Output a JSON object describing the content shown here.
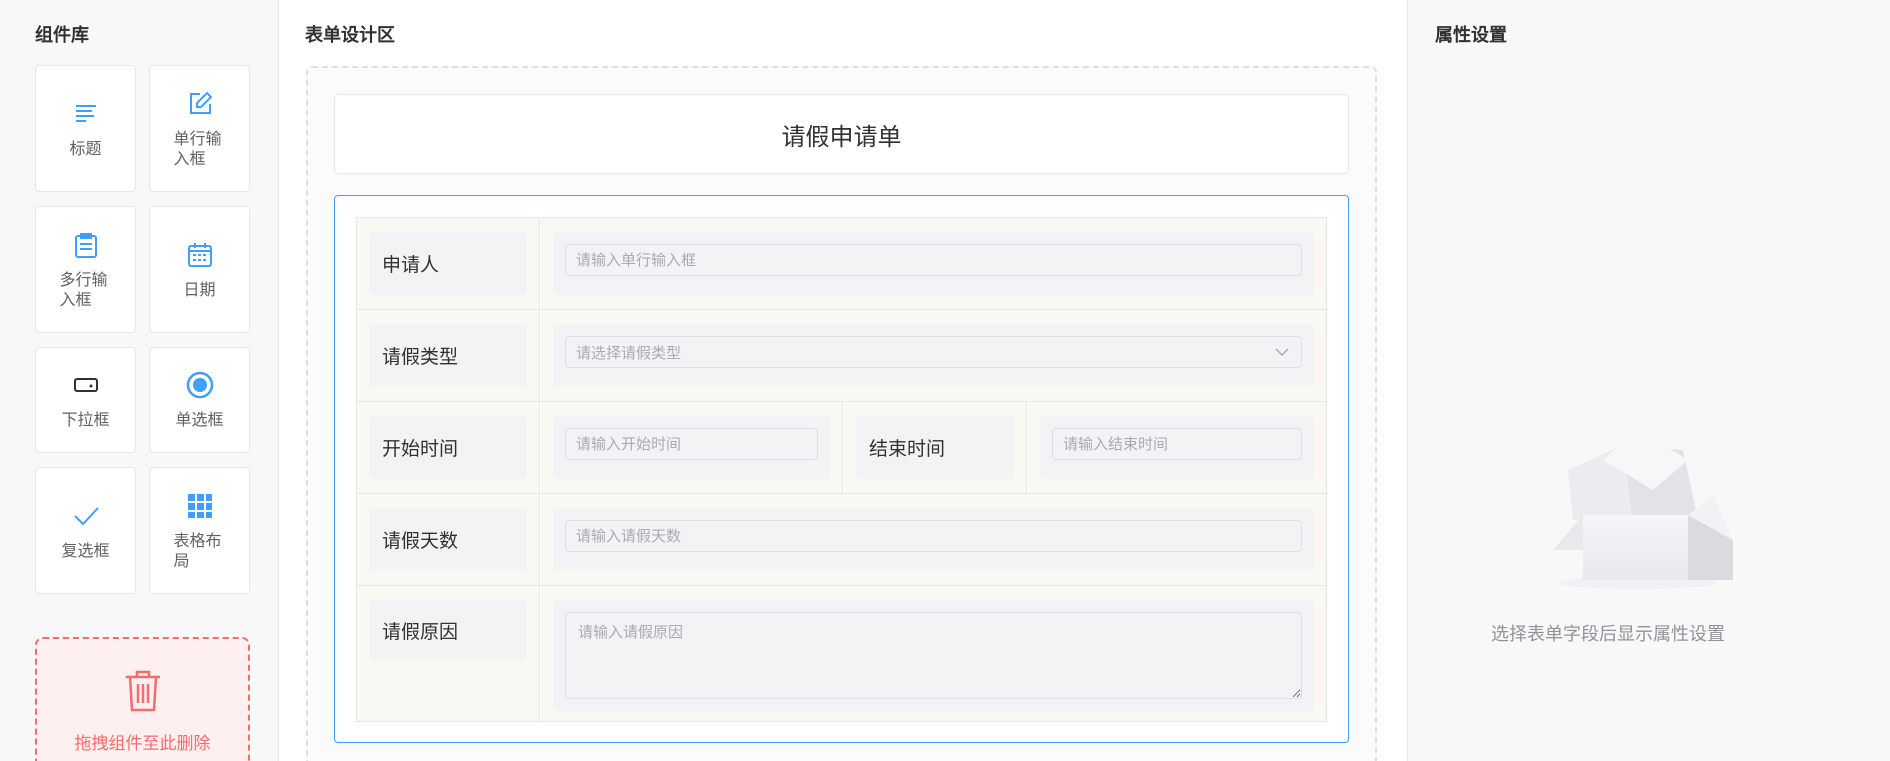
{
  "left": {
    "title": "组件库",
    "components": [
      {
        "label": "标题",
        "icon": "heading-icon"
      },
      {
        "label": "单行输入框",
        "icon": "edit-icon"
      },
      {
        "label": "多行输入框",
        "icon": "document-icon"
      },
      {
        "label": "日期",
        "icon": "calendar-icon"
      },
      {
        "label": "下拉框",
        "icon": "dropdown-icon"
      },
      {
        "label": "单选框",
        "icon": "radio-icon"
      },
      {
        "label": "复选框",
        "icon": "check-icon"
      },
      {
        "label": "表格布局",
        "icon": "grid-icon"
      }
    ],
    "trash_label": "拖拽组件至此删除"
  },
  "center": {
    "title": "表单设计区",
    "form_title": "请假申请单",
    "rows": {
      "applicant": {
        "label": "申请人",
        "placeholder": "请输入单行输入框"
      },
      "leave_type": {
        "label": "请假类型",
        "placeholder": "请选择请假类型"
      },
      "start_time": {
        "label": "开始时间",
        "placeholder": "请输入开始时间"
      },
      "end_time": {
        "label": "结束时间",
        "placeholder": "请输入结束时间"
      },
      "days": {
        "label": "请假天数",
        "placeholder": "请输入请假天数"
      },
      "reason": {
        "label": "请假原因",
        "placeholder": "请输入请假原因"
      }
    }
  },
  "right": {
    "title": "属性设置",
    "empty_text": "选择表单字段后显示属性设置"
  },
  "colors": {
    "accent": "#409eff",
    "danger": "#f56c6c",
    "cell_bg": "#faf8f2"
  }
}
